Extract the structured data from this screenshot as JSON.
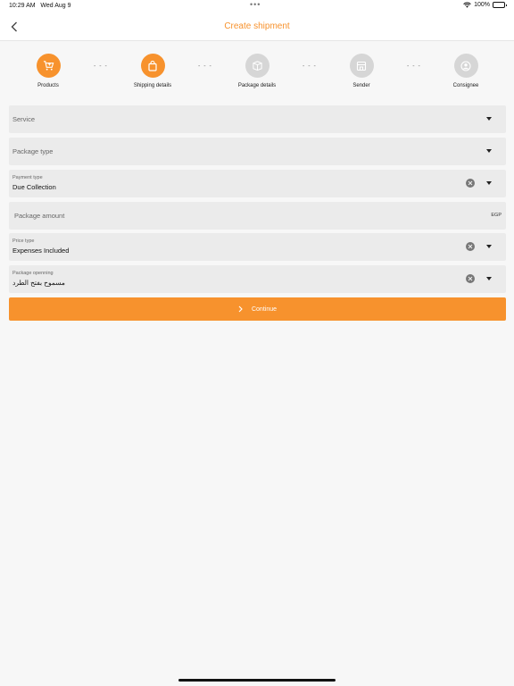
{
  "status_bar": {
    "time": "10:29 AM",
    "date": "Wed Aug 9",
    "dots": "•••",
    "battery": "100%"
  },
  "header": {
    "title": "Create shipment",
    "back_icon": "chevron-left-icon"
  },
  "colors": {
    "accent": "#f7922d",
    "inactive": "#d6d6d6",
    "field_bg": "#ebebeb",
    "page_bg": "#f7f7f7"
  },
  "steps": [
    {
      "label": "Products",
      "icon": "cart-icon",
      "state": "active"
    },
    {
      "label": "Shipping details",
      "icon": "bag-icon",
      "state": "active"
    },
    {
      "label": "Package details",
      "icon": "box-icon",
      "state": "inactive"
    },
    {
      "label": "Sender",
      "icon": "store-icon",
      "state": "inactive"
    },
    {
      "label": "Consignee",
      "icon": "user-icon",
      "state": "inactive"
    }
  ],
  "connector": "- - -",
  "form": {
    "service": {
      "placeholder": "Service"
    },
    "package_type": {
      "placeholder": "Package type"
    },
    "payment_type": {
      "label": "Payment type",
      "value": "Due Collection"
    },
    "package_amount": {
      "placeholder": "Package amount",
      "currency": "EGP"
    },
    "price_type": {
      "label": "Price type",
      "value": "Expenses Included"
    },
    "package_opening": {
      "label": "Package openning",
      "value": "مسموح بفتح الطرد"
    }
  },
  "continue_button": {
    "label": "Continue",
    "icon": "chevron-right-icon"
  }
}
